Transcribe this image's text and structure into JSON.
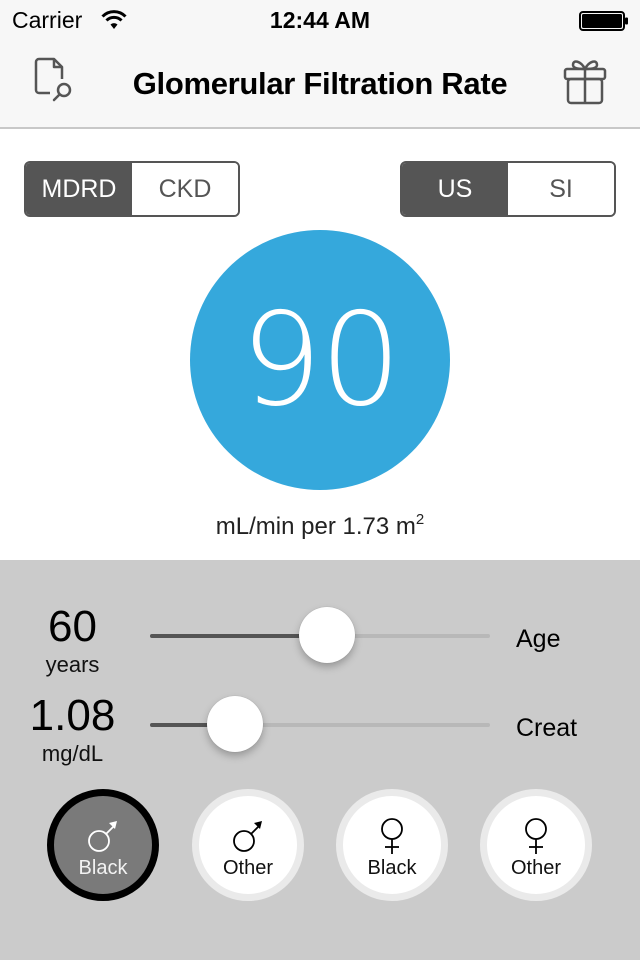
{
  "status_bar": {
    "carrier": "Carrier",
    "time": "12:44 AM",
    "wifi_icon": "wifi-icon",
    "battery_icon": "battery-full-icon"
  },
  "nav": {
    "title": "Glomerular Filtration Rate",
    "left_icon": "document-search-icon",
    "right_icon": "gift-icon"
  },
  "formula_toggle": {
    "options": [
      "MDRD",
      "CKD"
    ],
    "selected": "MDRD"
  },
  "units_toggle": {
    "options": [
      "US",
      "SI"
    ],
    "selected": "US"
  },
  "result": {
    "value": "90",
    "unit_text": "mL/min per 1.73 m",
    "unit_superscript": "2",
    "circle_color": "#35a8dc"
  },
  "sliders": {
    "age": {
      "value": "60",
      "unit": "years",
      "label": "Age",
      "fraction": 0.52
    },
    "creat": {
      "value": "1.08",
      "unit": "mg/dL",
      "label": "Creat",
      "fraction": 0.25
    }
  },
  "groups": [
    {
      "symbol": "male",
      "label": "Black",
      "selected": true
    },
    {
      "symbol": "male",
      "label": "Other",
      "selected": false
    },
    {
      "symbol": "female",
      "label": "Black",
      "selected": false
    },
    {
      "symbol": "female",
      "label": "Other",
      "selected": false
    }
  ]
}
